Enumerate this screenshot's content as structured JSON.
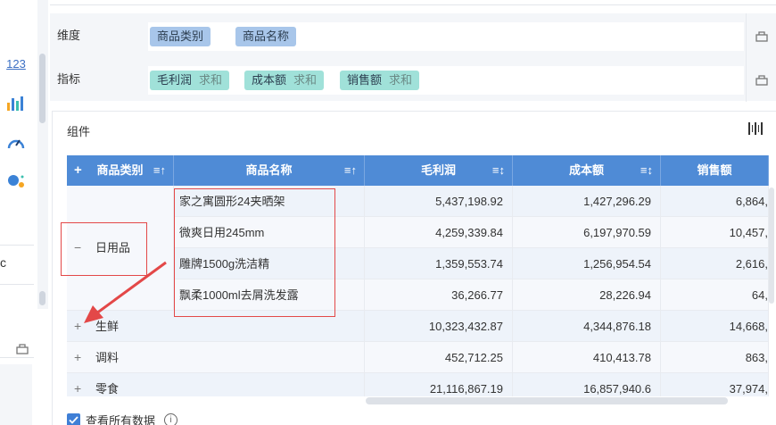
{
  "left_panel": {
    "icons": [
      "number-icon",
      "bar-chart-icon",
      "gauge-icon",
      "scatter-icon"
    ],
    "number_icon_text": "123",
    "cut_text": "c"
  },
  "dimension_row": {
    "label": "维度",
    "chips": [
      "商品类别",
      "商品名称"
    ]
  },
  "metric_row": {
    "label": "指标",
    "chips": [
      {
        "name": "毛利润",
        "agg": "求和"
      },
      {
        "name": "成本额",
        "agg": "求和"
      },
      {
        "name": "销售额",
        "agg": "求和"
      }
    ]
  },
  "component": {
    "title": "组件"
  },
  "table": {
    "headers": {
      "plus": "+",
      "category": "商品类别",
      "name": "商品名称",
      "profit": "毛利润",
      "cost": "成本额",
      "sales": "销售额"
    },
    "expanded_group": {
      "category": "日用品",
      "collapse_symbol": "−",
      "rows": [
        {
          "name": "家之寓圆形24夹晒架",
          "profit": "5,437,198.92",
          "cost": "1,427,296.29",
          "sales": "6,864,"
        },
        {
          "name": "微爽日用245mm",
          "profit": "4,259,339.84",
          "cost": "6,197,970.59",
          "sales": "10,457,"
        },
        {
          "name": "雕牌1500g洗洁精",
          "profit": "1,359,553.74",
          "cost": "1,256,954.54",
          "sales": "2,616,"
        },
        {
          "name": "飘柔1000ml去屑洗发露",
          "profit": "36,266.77",
          "cost": "28,226.94",
          "sales": "64,"
        }
      ]
    },
    "collapsed_groups": [
      {
        "category": "生鲜",
        "expand_symbol": "+",
        "profit": "10,323,432.87",
        "cost": "4,344,876.18",
        "sales": "14,668,"
      },
      {
        "category": "调料",
        "expand_symbol": "+",
        "profit": "452,712.25",
        "cost": "410,413.78",
        "sales": "863,"
      },
      {
        "category": "零食",
        "expand_symbol": "+",
        "profit": "21,116,867.19",
        "cost": "16,857,940.6",
        "sales": "37,974,"
      }
    ]
  },
  "footer": {
    "view_all_label": "查看所有数据",
    "checked": true
  },
  "colors": {
    "header_blue": "#4f8bd6",
    "dimension_chip": "#a8c6ea",
    "metric_chip": "#a0e1d9",
    "annotation_red": "#e34848"
  }
}
